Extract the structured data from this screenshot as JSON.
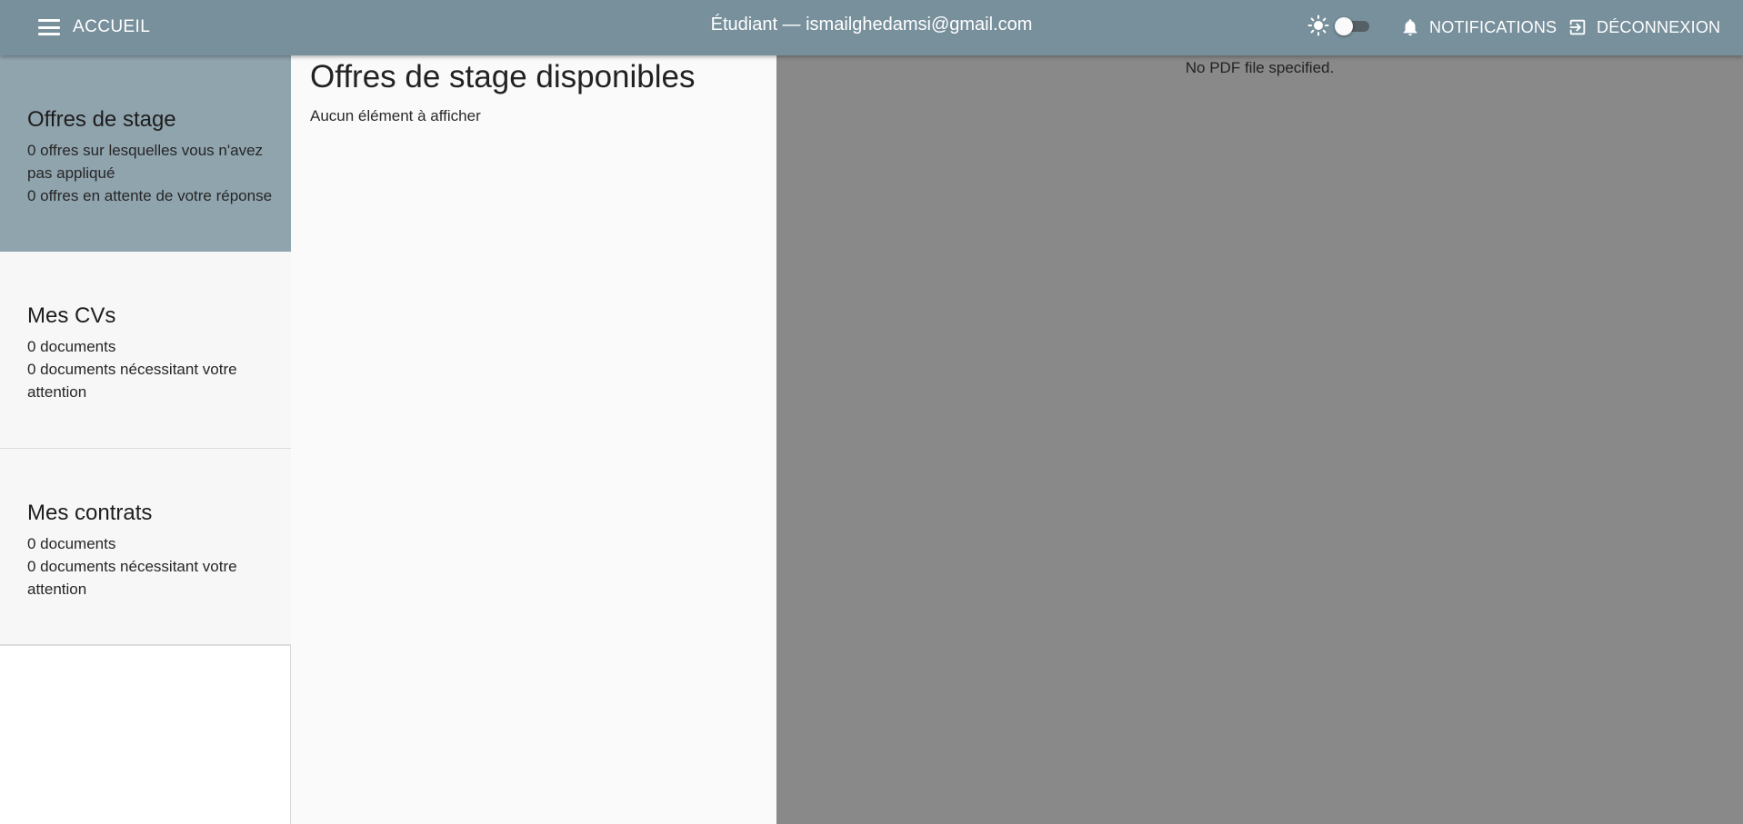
{
  "appbar": {
    "home_label": "ACCUEIL",
    "title": "Étudiant — ismailghedamsi@gmail.com",
    "notifications_label": "NOTIFICATIONS",
    "logout_label": "DÉCONNEXION",
    "theme_toggle_on": false,
    "colors": {
      "background": "#78909c",
      "text": "#ffffff"
    }
  },
  "sidebar": {
    "cards": [
      {
        "title": "Offres de stage",
        "line1": "0 offres sur lesquelles vous n'avez pas appliqué",
        "line2": "0 offres en attente de votre réponse",
        "selected": true
      },
      {
        "title": "Mes CVs",
        "line1": "0 documents",
        "line2": "0 documents nécessitant votre attention",
        "selected": false
      },
      {
        "title": "Mes contrats",
        "line1": "0 documents",
        "line2": "0 documents nécessitant votre attention",
        "selected": false
      }
    ],
    "colors": {
      "selected": "#90a4ae",
      "default": "#f7f7f7"
    }
  },
  "main": {
    "heading": "Offres de stage disponibles",
    "empty_text": "Aucun élément à afficher"
  },
  "pdf_viewer": {
    "message": "No PDF file specified.",
    "background": "#898989"
  }
}
